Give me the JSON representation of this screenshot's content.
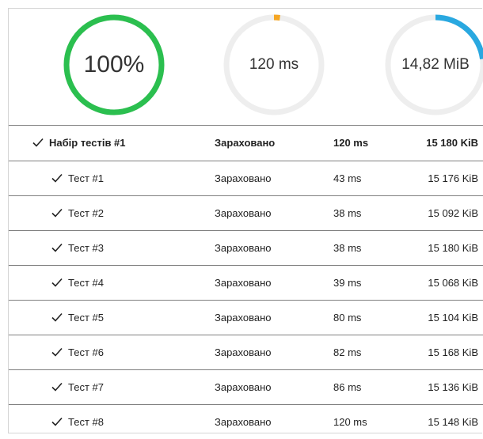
{
  "gauges": {
    "score": {
      "label": "100%",
      "fraction": 1.0,
      "color": "#2bbf4f"
    },
    "time": {
      "label": "120 ms",
      "fraction": 0.02,
      "color": "#f5a623"
    },
    "memory": {
      "label": "14,82 MiB",
      "fraction": 0.23,
      "color": "#29a8e0"
    },
    "track_color": "#eeeeee"
  },
  "group": {
    "name": "Набір тестів #1",
    "status": "Зараховано",
    "time": "120 ms",
    "memory": "15 180 KiB"
  },
  "tests": [
    {
      "name": "Тест #1",
      "status": "Зараховано",
      "time": "43 ms",
      "memory": "15 176 KiB"
    },
    {
      "name": "Тест #2",
      "status": "Зараховано",
      "time": "38 ms",
      "memory": "15 092 KiB"
    },
    {
      "name": "Тест #3",
      "status": "Зараховано",
      "time": "38 ms",
      "memory": "15 180 KiB"
    },
    {
      "name": "Тест #4",
      "status": "Зараховано",
      "time": "39 ms",
      "memory": "15 068 KiB"
    },
    {
      "name": "Тест #5",
      "status": "Зараховано",
      "time": "80 ms",
      "memory": "15 104 KiB"
    },
    {
      "name": "Тест #6",
      "status": "Зараховано",
      "time": "82 ms",
      "memory": "15 168 KiB"
    },
    {
      "name": "Тест #7",
      "status": "Зараховано",
      "time": "86 ms",
      "memory": "15 136 KiB"
    },
    {
      "name": "Тест #8",
      "status": "Зараховано",
      "time": "120 ms",
      "memory": "15 148 KiB"
    }
  ]
}
